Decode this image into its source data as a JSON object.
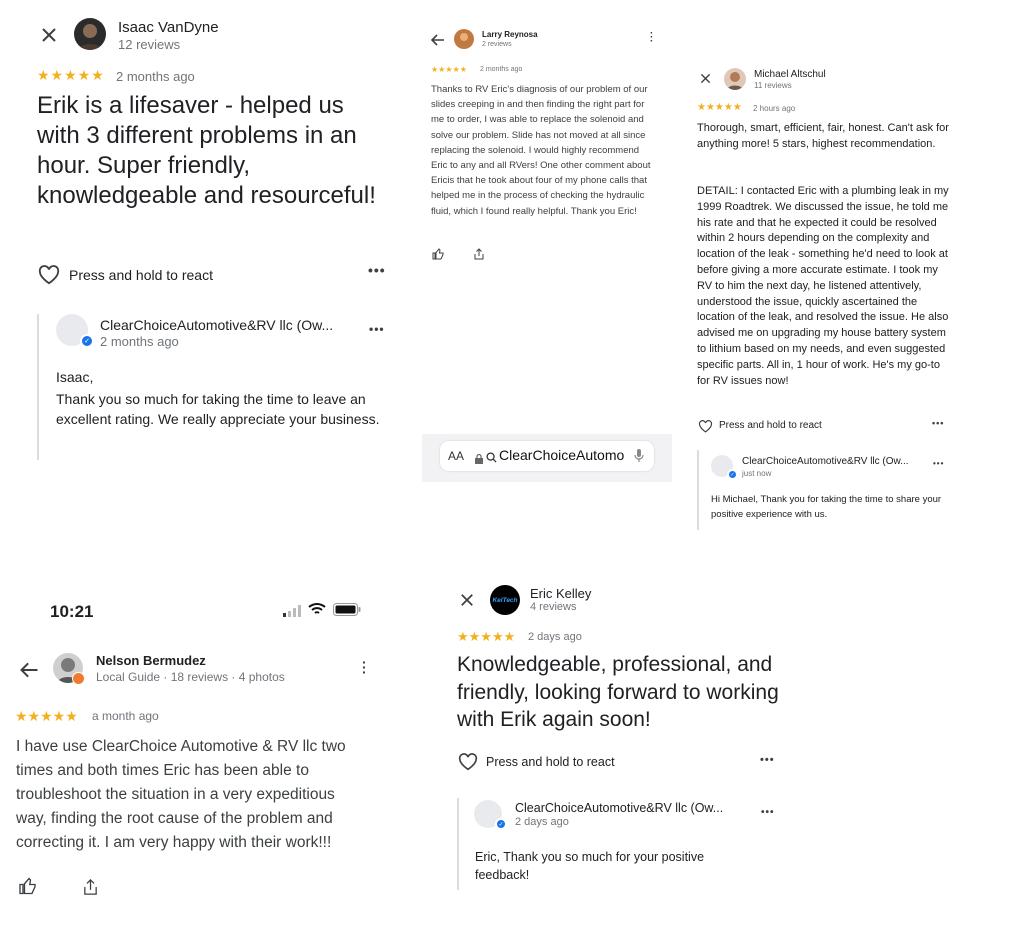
{
  "panel1": {
    "reviewer_name": "Isaac VanDyne",
    "reviewer_meta": "12 reviews",
    "stars": "★★★★★",
    "time": "2 months ago",
    "review_text": "Erik is a lifesaver - helped us with 3 different problems in an hour. Super friendly, knowledgeable and resourceful!",
    "react_label": "Press and hold to react",
    "owner_name": "ClearChoiceAutomotive&RV llc (Ow...",
    "owner_time": "2 months ago",
    "owner_reply_greeting": "Isaac,",
    "owner_reply_text": "Thank you so much for taking the time to leave an excellent rating. We really appreciate your business."
  },
  "panel2": {
    "reviewer_name": "Larry Reynosa",
    "reviewer_meta": "2 reviews",
    "stars": "★★★★★",
    "time": "2 months ago",
    "review_text": "Thanks to RV Eric's diagnosis of our problem of our slides creeping in and then finding the right part for me to order, I was able to replace the solenoid and solve our problem. Slide has not moved at all since replacing the solenoid. I would highly recommend Eric to any and all RVers! One other comment about Ericis that he took about four of my phone calls that helped me in the process of checking the hydraulic fluid, which I found really helpful. Thank you Eric!",
    "address_bar": {
      "text_size": "AA",
      "url": "ClearChoiceAutomo"
    }
  },
  "panel3": {
    "reviewer_name": "Michael Altschul",
    "reviewer_meta": "11 reviews",
    "stars": "★★★★★",
    "time": "2 hours ago",
    "review_text_p1": "Thorough, smart, efficient, fair, honest. Can't ask for anything more! 5 stars, highest recommendation.",
    "review_text_p2": "DETAIL: I contacted Eric with a plumbing leak in my 1999 Roadtrek. We discussed the issue, he told me his rate and that he expected it could be resolved within 2 hours depending on the complexity and location of the leak - something he'd need to look at before giving a more accurate estimate. I took my RV to him the next day, he listened attentively, understood the issue, quickly ascertained the location of the leak, and resolved the issue. He also advised me on upgrading my house battery system to lithium based on my needs, and even suggested specific parts. All in, 1 hour of work. He's my go-to for RV issues now!",
    "react_label": "Press and hold to react",
    "owner_name": "ClearChoiceAutomotive&RV llc (Ow...",
    "owner_time": "just now",
    "owner_reply_text": "Hi Michael, Thank you for taking the time to share your positive experience with us."
  },
  "panel4": {
    "status_time": "10:21",
    "reviewer_name": "Nelson Bermudez",
    "reviewer_meta": "Local Guide · 18 reviews · 4 photos",
    "stars": "★★★★★",
    "time": "a month ago",
    "review_text": "I have use ClearChoice Automotive & RV llc two times and both times Eric has been able to troubleshoot the situation in a very expeditious way, finding the root cause of the problem and correcting it. I am very happy with their work!!!"
  },
  "panel5": {
    "reviewer_name": "Eric Kelley",
    "reviewer_meta": "4 reviews",
    "avatar_text": "KelTech",
    "stars": "★★★★★",
    "time": "2 days ago",
    "review_text": "Knowledgeable, professional, and friendly, looking forward to working with Erik again soon!",
    "react_label": "Press and hold to react",
    "owner_name": "ClearChoiceAutomotive&RV llc (Ow...",
    "owner_time": "2 days ago",
    "owner_reply_text": "Eric, Thank you so much for your positive feedback!"
  },
  "colors": {
    "star": "#f2b01e",
    "verified_blue": "#1a73e8",
    "muted_text": "#70757a",
    "divider": "#dadce0"
  }
}
